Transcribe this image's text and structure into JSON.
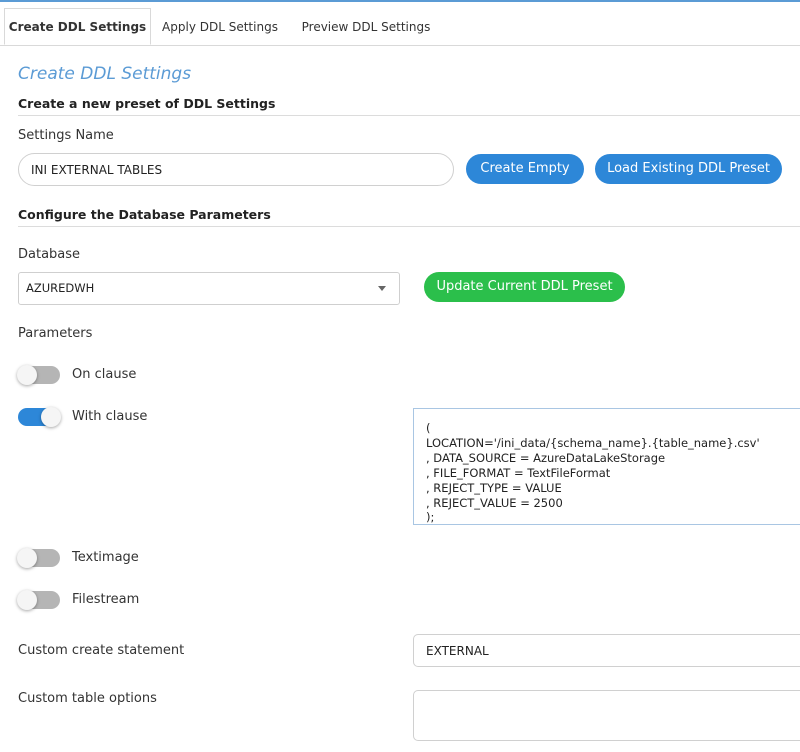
{
  "tabs": [
    {
      "label": "Create DDL Settings",
      "active": true
    },
    {
      "label": "Apply DDL Settings",
      "active": false
    },
    {
      "label": "Preview DDL Settings",
      "active": false
    }
  ],
  "page_title": "Create DDL Settings",
  "create_section": {
    "heading": "Create a new preset of DDL Settings",
    "settings_name_label": "Settings Name",
    "settings_name_value": "INI EXTERNAL TABLES",
    "create_empty_label": "Create Empty",
    "load_existing_label": "Load Existing DDL Preset"
  },
  "db_section": {
    "heading": "Configure the Database Parameters",
    "database_label": "Database",
    "database_value": "AZUREDWH",
    "update_label": "Update Current DDL Preset"
  },
  "parameters": {
    "label": "Parameters",
    "toggles": [
      {
        "label": "On clause",
        "on": false
      },
      {
        "label": "With clause",
        "on": true
      },
      {
        "label": "Textimage",
        "on": false
      },
      {
        "label": "Filestream",
        "on": false
      }
    ],
    "with_clause_text": "(\nLOCATION='/ini_data/{schema_name}.{table_name}.csv'\n, DATA_SOURCE = AzureDataLakeStorage\n, FILE_FORMAT = TextFileFormat\n, REJECT_TYPE = VALUE\n, REJECT_VALUE = 2500\n);",
    "custom_create_label": "Custom create statement",
    "custom_create_value": "EXTERNAL",
    "custom_table_label": "Custom table options",
    "custom_table_value": ""
  },
  "colors": {
    "accent_blue": "#2d87d8",
    "accent_green": "#2bbf4b",
    "title_blue": "#5b9bd5"
  }
}
